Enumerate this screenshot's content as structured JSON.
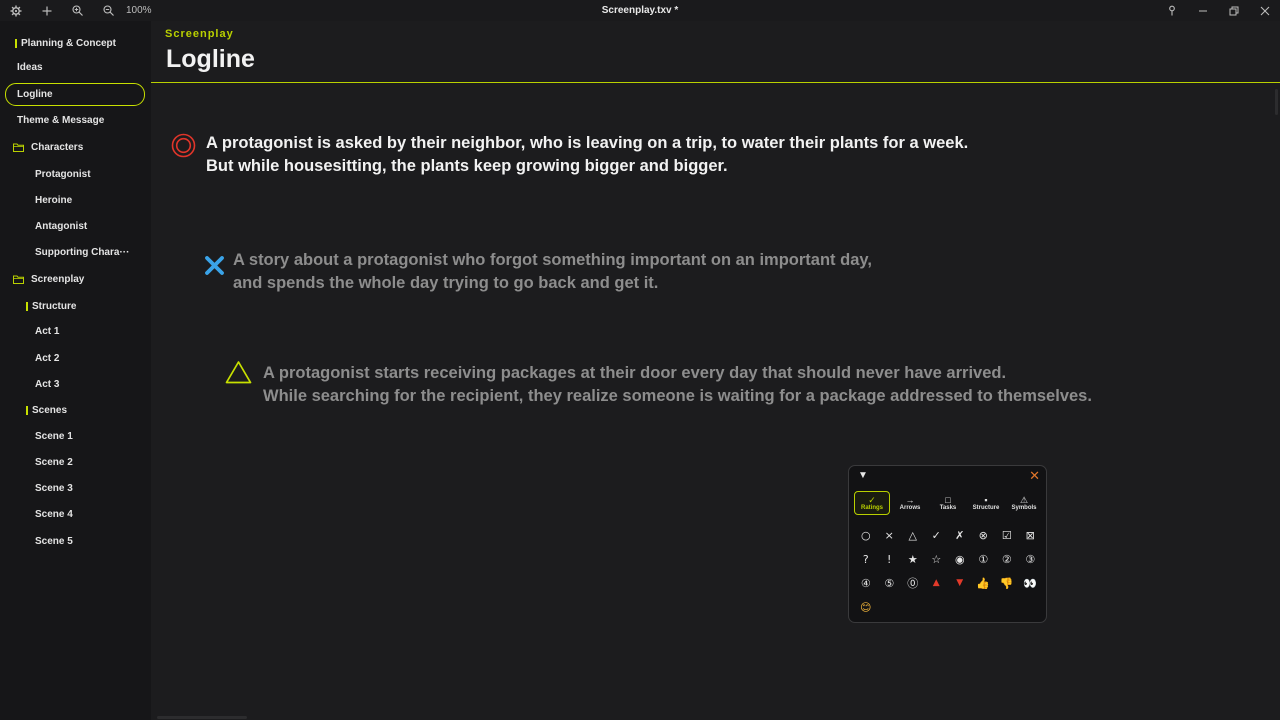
{
  "window": {
    "title": "Screenplay.txv *",
    "zoom": "100%"
  },
  "sidebar": {
    "items": [
      {
        "label": "Planning & Concept"
      },
      {
        "label": "Ideas"
      },
      {
        "label": "Logline"
      },
      {
        "label": "Theme & Message"
      },
      {
        "label": "Characters"
      },
      {
        "label": "Protagonist"
      },
      {
        "label": "Heroine"
      },
      {
        "label": "Antagonist"
      },
      {
        "label": "Supporting Chara···"
      },
      {
        "label": "Screenplay"
      },
      {
        "label": "Structure"
      },
      {
        "label": "Act 1"
      },
      {
        "label": "Act 2"
      },
      {
        "label": "Act 3"
      },
      {
        "label": "Scenes"
      },
      {
        "label": "Scene 1"
      },
      {
        "label": "Scene 2"
      },
      {
        "label": "Scene 3"
      },
      {
        "label": "Scene 4"
      },
      {
        "label": "Scene 5"
      }
    ]
  },
  "main": {
    "breadcrumb": "Screenplay",
    "title": "Logline",
    "loglines": [
      {
        "icon": "double-circle-icon",
        "line1": "A protagonist is asked by their neighbor, who is leaving on a trip, to water their plants for a week.",
        "line2": "But while housesitting, the plants keep growing bigger and bigger."
      },
      {
        "icon": "cross-icon",
        "line1": "A story about a protagonist who forgot something important on an important day,",
        "line2": "and spends the whole day trying to go back and get it."
      },
      {
        "icon": "triangle-icon",
        "line1": "A protagonist starts receiving packages at their door every day that should never have arrived.",
        "line2": "While searching for the recipient, they realize someone is waiting for a package addressed to themselves."
      }
    ]
  },
  "palette": {
    "collapse_glyph": "▼",
    "close_glyph": "✕",
    "tabs": [
      {
        "glyph": "✓",
        "label": "Ratings"
      },
      {
        "glyph": "→",
        "label": "Arrows"
      },
      {
        "glyph": "□",
        "label": "Tasks"
      },
      {
        "glyph": "▪",
        "label": "Structure"
      },
      {
        "glyph": "⚠",
        "label": "Symbols"
      }
    ],
    "symbols": [
      "○",
      "×",
      "△",
      "✓",
      "✗",
      "⊗",
      "☑",
      "⊠",
      "?",
      "!",
      "★",
      "☆",
      "◉",
      "①",
      "②",
      "③",
      "④",
      "⑤",
      "⓪",
      "▲",
      "▼",
      "👍",
      "👎",
      "👀",
      "😊"
    ],
    "accent_color": "#b9d000",
    "close_color": "#e0752a"
  }
}
